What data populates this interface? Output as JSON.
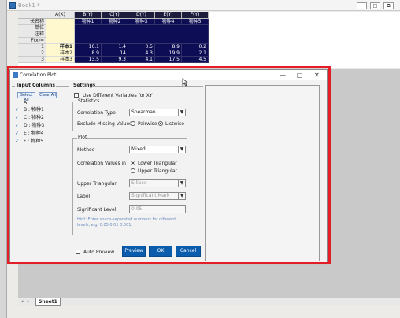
{
  "book": {
    "title": "Book1 *",
    "win_buttons": [
      "—",
      "□",
      "⧉"
    ]
  },
  "sheet": {
    "col_headers": [
      "A(X)",
      "B(Y)",
      "C(Y)",
      "D(Y)",
      "E(Y)",
      "F(Y)"
    ],
    "row_labels": [
      "长名称",
      "单位",
      "注释",
      "F(x)=",
      "1",
      "2",
      "3"
    ],
    "long_names": [
      "",
      "物种1",
      "物种2",
      "物种3",
      "物种4",
      "物种5"
    ],
    "rows": [
      [
        "样本1",
        "10.1",
        "1.4",
        "0.5",
        "8.9",
        "0.2"
      ],
      [
        "样本2",
        "8.9",
        "14",
        "4.3",
        "19.9",
        "2.1"
      ],
      [
        "样本3",
        "13.5",
        "9.3",
        "4.1",
        "17.5",
        "4.5"
      ]
    ]
  },
  "tabs": {
    "sheet_tab": "Sheet1",
    "nav": [
      "◂",
      "▸"
    ]
  },
  "dialog": {
    "title": "Correlation Plot",
    "controls": [
      "—",
      "□",
      "✕"
    ],
    "input_columns": {
      "label": "Input Columns",
      "select_all": "Select All",
      "clear_all": "Clear All",
      "header": "A",
      "items": [
        "B : 物种1",
        "C : 物种2",
        "D : 物种3",
        "E : 物种4",
        "F : 物种5"
      ]
    },
    "settings": {
      "label": "Settings",
      "use_diff_vars": "Use Different Variables for XY",
      "statistics": {
        "label": "Statistics",
        "corr_type_label": "Correlation Type",
        "corr_type_value": "Spearman",
        "exclude_label": "Exclude Missing Values",
        "pairwise": "Pairwise",
        "listwise": "Listwise"
      },
      "plot": {
        "label": "Plot",
        "method_label": "Method",
        "method_value": "Mixed",
        "values_in_label": "Correlation Values in",
        "lower": "Lower Triangular",
        "upper": "Upper Triangular",
        "upper_tri_label": "Upper Triangular",
        "upper_tri_value": "Ellipse",
        "label_label": "Label",
        "label_value": "Significant Mark",
        "sig_level_label": "Significant Level",
        "sig_level_value": "0.05",
        "hint": "Hint: Enter space-separated numbers for different levels, e.g. 0.05 0.01 0.001."
      }
    },
    "auto_preview": "Auto Preview",
    "preview_btn": "Preview",
    "ok_btn": "OK",
    "cancel_btn": "Cancel"
  },
  "icons": {
    "dropdown": "▼",
    "check": "✓"
  },
  "colors": {
    "highlight": "#e41e26",
    "button": "#0b5cad",
    "selected_col": "#0d0d55"
  }
}
